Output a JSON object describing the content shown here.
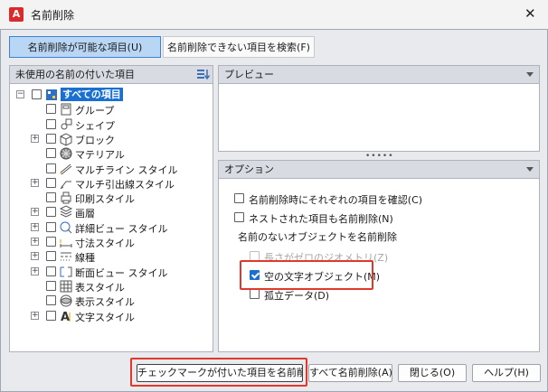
{
  "window": {
    "title": "名前削除",
    "app_icon_letter": "A"
  },
  "tabs": [
    {
      "label": "名前削除が可能な項目(U)",
      "active": true
    },
    {
      "label": "名前削除できない項目を検索(F)",
      "active": false
    }
  ],
  "tree": {
    "header": "未使用の名前の付いた項目",
    "items": [
      {
        "label": "すべての項目",
        "icon": "all-items-icon",
        "expandable": true,
        "selected": true
      },
      {
        "label": "グループ",
        "icon": "group-icon",
        "expandable": false
      },
      {
        "label": "シェイプ",
        "icon": "shape-icon",
        "expandable": false
      },
      {
        "label": "ブロック",
        "icon": "block-icon",
        "expandable": true
      },
      {
        "label": "マテリアル",
        "icon": "material-icon",
        "expandable": false
      },
      {
        "label": "マルチライン スタイル",
        "icon": "multiline-style-icon",
        "expandable": false
      },
      {
        "label": "マルチ引出線スタイル",
        "icon": "multileader-style-icon",
        "expandable": true
      },
      {
        "label": "印刷スタイル",
        "icon": "plot-style-icon",
        "expandable": false
      },
      {
        "label": "画層",
        "icon": "layer-icon",
        "expandable": true
      },
      {
        "label": "詳細ビュー スタイル",
        "icon": "detail-view-style-icon",
        "expandable": true
      },
      {
        "label": "寸法スタイル",
        "icon": "dimension-style-icon",
        "expandable": true
      },
      {
        "label": "線種",
        "icon": "linetype-icon",
        "expandable": true
      },
      {
        "label": "断面ビュー スタイル",
        "icon": "section-view-style-icon",
        "expandable": true
      },
      {
        "label": "表スタイル",
        "icon": "table-style-icon",
        "expandable": false
      },
      {
        "label": "表示スタイル",
        "icon": "visual-style-icon",
        "expandable": false
      },
      {
        "label": "文字スタイル",
        "icon": "text-style-icon",
        "expandable": true
      }
    ]
  },
  "preview": {
    "header": "プレビュー"
  },
  "options": {
    "header": "オプション",
    "confirm_each": {
      "label": "名前削除時にそれぞれの項目を確認(C)",
      "checked": false
    },
    "purge_nested": {
      "label": "ネストされた項目も名前削除(N)",
      "checked": false
    },
    "unnamed_group_label": "名前のないオブジェクトを名前削除",
    "zero_length_geometry": {
      "label": "長さがゼロのジオメトリ(Z)",
      "checked": false,
      "enabled": false
    },
    "empty_text": {
      "label": "空の文字オブジェクト(M)",
      "checked": true
    },
    "orphaned_data": {
      "label": "孤立データ(D)",
      "checked": false
    }
  },
  "buttons": {
    "purge_checked": "チェックマークが付いた項目を名前削除(P)",
    "purge_all": "すべて名前削除(A)",
    "close": "閉じる(O)",
    "help": "ヘルプ(H)"
  },
  "colors": {
    "accent": "#1a6fd3",
    "highlight_box": "#e0392b",
    "tab_active_bg": "#b9d7f4",
    "app_icon": "#d92b2b"
  }
}
